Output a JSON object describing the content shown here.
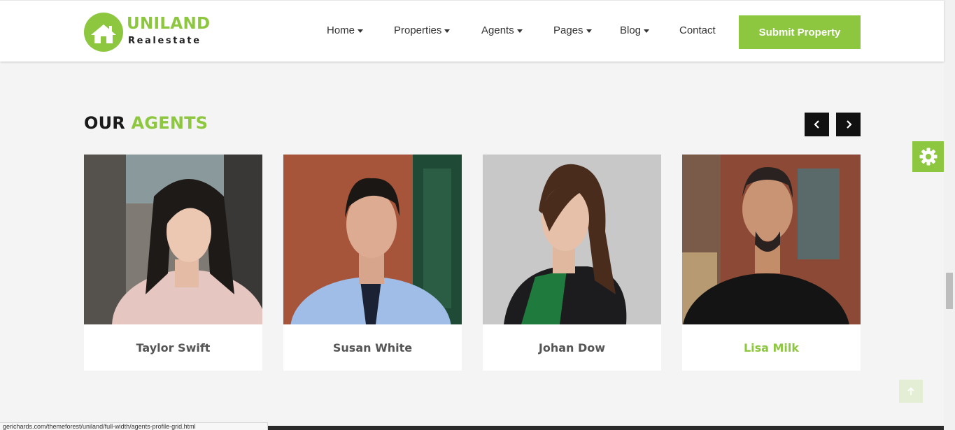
{
  "brand": {
    "name": "UNILAND",
    "tagline": "Realestate",
    "accent_color": "#8dc63f"
  },
  "nav": {
    "items": [
      {
        "label": "Home",
        "dropdown": true
      },
      {
        "label": "Properties",
        "dropdown": true
      },
      {
        "label": "Agents",
        "dropdown": true
      },
      {
        "label": "Pages",
        "dropdown": true
      },
      {
        "label": "Blog",
        "dropdown": true
      },
      {
        "label": "Contact",
        "dropdown": false
      }
    ],
    "cta_label": "Submit Property"
  },
  "section": {
    "title_main": "OUR",
    "title_accent": "AGENTS",
    "prev_icon": "chevron-left-icon",
    "next_icon": "chevron-right-icon"
  },
  "agents": [
    {
      "name": "Taylor Swift",
      "active": false
    },
    {
      "name": "Susan White",
      "active": false
    },
    {
      "name": "Johan Dow",
      "active": false
    },
    {
      "name": "Lisa Milk",
      "active": true
    }
  ],
  "widgets": {
    "settings_icon": "gear-icon",
    "back_to_top_icon": "arrow-up-icon"
  },
  "status_bar": {
    "url": "gerichards.com/themeforest/uniland/full-width/agents-profile-grid.html"
  }
}
